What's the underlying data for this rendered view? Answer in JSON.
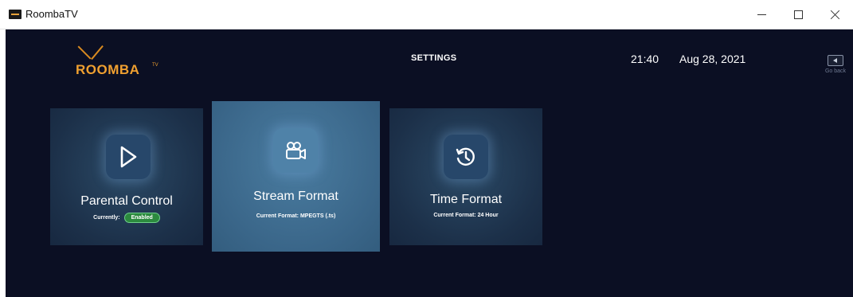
{
  "window": {
    "title": "RoombaTV",
    "controls": [
      "minimize",
      "maximize",
      "close"
    ]
  },
  "header": {
    "logo_text": "ROOMBA",
    "logo_superscript": "TV",
    "title": "SETTINGS",
    "time": "21:40",
    "date": "Aug 28, 2021",
    "go_back_label": "Go back"
  },
  "cards": {
    "parental": {
      "icon": "play-icon",
      "title": "Parental Control",
      "status_prefix": "Currently:",
      "status_value": "Enabled"
    },
    "stream": {
      "icon": "video-camera-icon",
      "title": "Stream Format",
      "subtitle": "Current Format: MPEGTS (.ts)"
    },
    "time": {
      "icon": "history-clock-icon",
      "title": "Time Format",
      "subtitle": "Current Format: 24 Hour"
    }
  },
  "colors": {
    "background": "#0b0f23",
    "accent": "#f0a030",
    "card": "#1c3049",
    "card_selected": "#3a6689",
    "badge": "#2b8a3e"
  }
}
